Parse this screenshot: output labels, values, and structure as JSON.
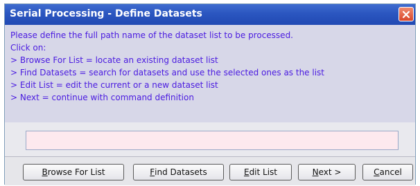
{
  "window": {
    "title": "Serial Processing - Define Datasets"
  },
  "instructions": {
    "lines": [
      "Please define the full path name of the dataset list to be processed.",
      "Click on:",
      "> Browse For List = locate an existing dataset list",
      "> Find Datasets = search for datasets and use the selected ones as the list",
      "> Edit List = edit the current or a new dataset list",
      "> Next = continue with command definition"
    ]
  },
  "path_input": {
    "value": ""
  },
  "buttons": {
    "browse": {
      "mnemonic": "B",
      "rest": "rowse For List"
    },
    "find": {
      "mnemonic": "F",
      "rest": "ind Datasets"
    },
    "edit": {
      "mnemonic": "E",
      "rest": "dit List"
    },
    "next": {
      "mnemonic": "N",
      "rest": "ext >"
    },
    "cancel": {
      "mnemonic": "C",
      "rest": "ancel"
    }
  },
  "colors": {
    "title_bar": "#2b56c0",
    "instruction_text": "#4b1ce0",
    "instruction_bg": "#d7d7e8",
    "input_bg": "#fde9ee",
    "close_button": "#d9462a"
  },
  "icons": {
    "close": "close-icon"
  }
}
